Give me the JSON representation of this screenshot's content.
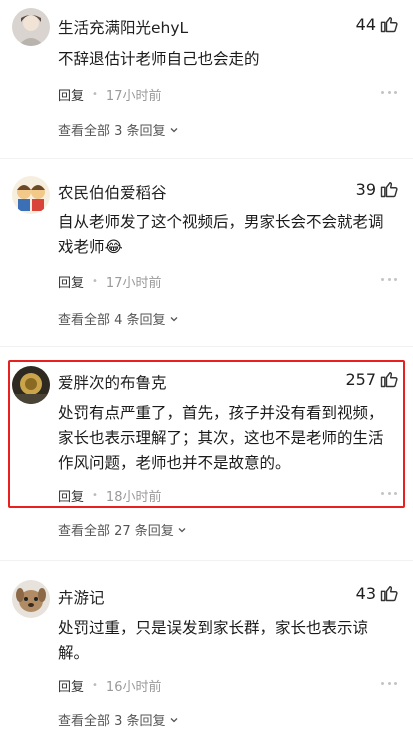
{
  "comments": [
    {
      "username": "生活充满阳光ehyL",
      "likes": "44",
      "text_lines": [
        "不辞退估计老师自己也会走的"
      ],
      "reply": "回复",
      "time": "17小时前",
      "view_all": "查看全部 3 条回复"
    },
    {
      "username": "农民伯伯爱稻谷",
      "likes": "39",
      "text_lines": [
        "自从老师发了这个视频后，男家长会不会就老调",
        "戏老师😂"
      ],
      "reply": "回复",
      "time": "17小时前",
      "view_all": "查看全部 4 条回复"
    },
    {
      "username": "爱胖次的布鲁克",
      "likes": "257",
      "text_lines": [
        "处罚有点严重了，首先，孩子并没有看到视频，",
        "家长也表示理解了；其次，这也不是老师的生活",
        "作风问题，老师也并不是故意的。"
      ],
      "reply": "回复",
      "time": "18小时前",
      "view_all": "查看全部 27 条回复",
      "highlighted": true
    },
    {
      "username": "卉游记",
      "likes": "43",
      "text_lines": [
        "处罚过重，只是误发到家长群，家长也表示谅",
        "解。"
      ],
      "reply": "回复",
      "time": "16小时前",
      "view_all": "查看全部 3 条回复"
    }
  ],
  "colors": {
    "highlight": "#e8201f",
    "meta": "#9a9a9a"
  },
  "icons": {
    "like": "thumbs-up-icon",
    "more": "more-dots-icon",
    "expand": "chevron-down-icon"
  }
}
